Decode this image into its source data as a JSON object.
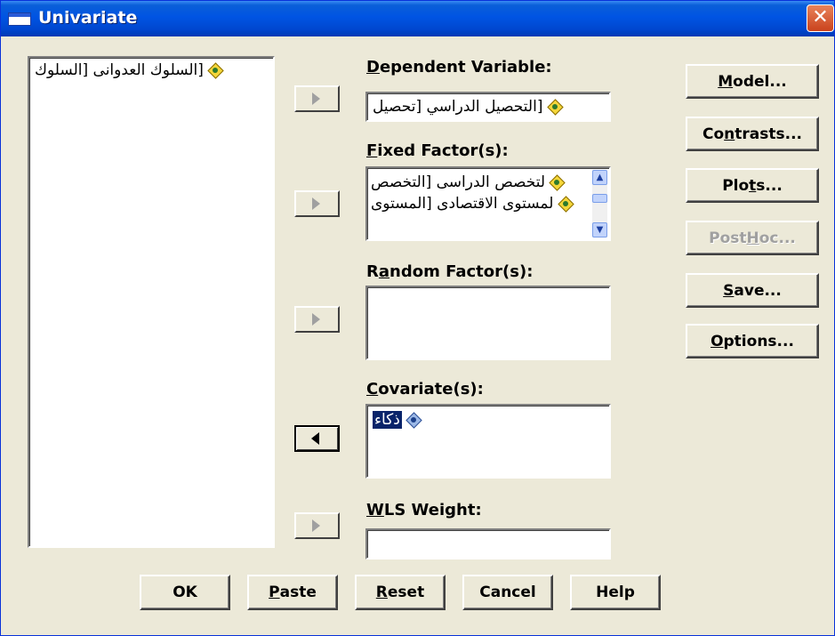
{
  "window": {
    "title": "Univariate",
    "close_glyph": "✕"
  },
  "source_list": {
    "items": [
      "[السلوك العدوانى [السلوك"
    ]
  },
  "dependent": {
    "label_key": "D",
    "label_rest": "ependent Variable:",
    "value": "[التحصيل الدراسي [تحصيل"
  },
  "fixed": {
    "label_key": "F",
    "label_rest": "ixed Factor(s):",
    "items": [
      "لتخصص الدراسى [التخصص",
      "لمستوى الاقتصادى [المستوى"
    ]
  },
  "random": {
    "label_pre": "R",
    "label_key": "a",
    "label_rest": "ndom Factor(s):"
  },
  "covariate": {
    "label_key": "C",
    "label_rest": "ovariate(s):",
    "items": [
      "ذكاء"
    ]
  },
  "wls": {
    "label_key": "W",
    "label_rest": "LS Weight:"
  },
  "side_buttons": {
    "model_key": "M",
    "model_rest": "odel...",
    "contrasts_pre": "Co",
    "contrasts_key": "n",
    "contrasts_rest": "trasts...",
    "plots_pre": "Plo",
    "plots_key": "t",
    "plots_rest": "s...",
    "posthoc_pre": "Post ",
    "posthoc_key": "H",
    "posthoc_rest": "oc...",
    "save_key": "S",
    "save_rest": "ave...",
    "options_key": "O",
    "options_rest": "ptions..."
  },
  "bottom_buttons": {
    "ok": "OK",
    "paste_key": "P",
    "paste_rest": "aste",
    "reset_key": "R",
    "reset_rest": "eset",
    "cancel": "Cancel",
    "help": "Help"
  },
  "colors": {
    "title_bar": "#0054e3",
    "dialog_bg": "#ece9d8",
    "selection": "#0a246a"
  },
  "icons": [
    "window-icon",
    "close-icon",
    "variable-icon",
    "arrow-right-icon",
    "arrow-left-icon",
    "scroll-up-icon",
    "scroll-down-icon"
  ]
}
